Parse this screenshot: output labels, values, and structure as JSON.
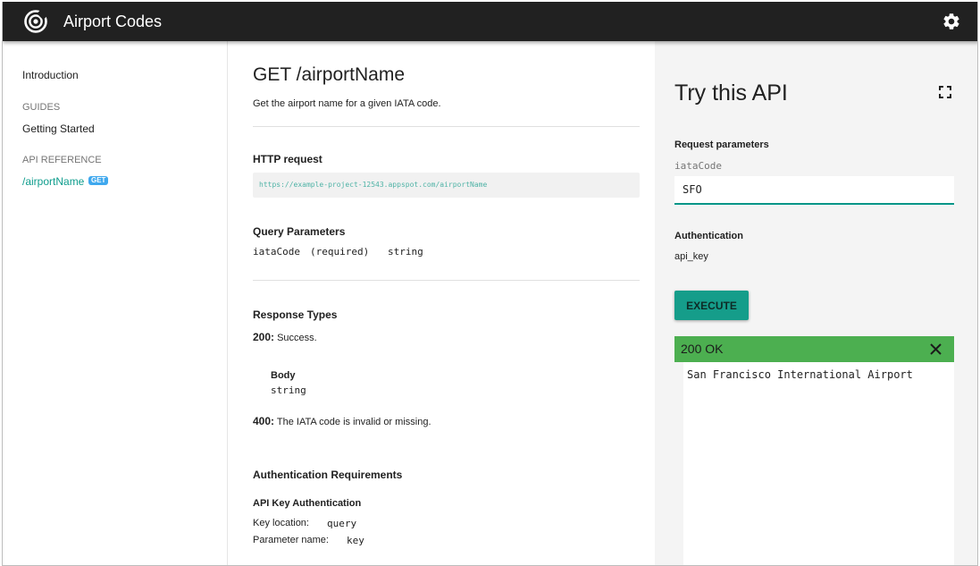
{
  "header": {
    "title": "Airport Codes",
    "logo_icon": "target-logo-icon",
    "settings_icon": "gear-icon"
  },
  "sidebar": {
    "intro": "Introduction",
    "guides_heading": "GUIDES",
    "getting_started": "Getting Started",
    "api_reference_heading": "API REFERENCE",
    "active_item": "/airportName",
    "active_badge": "GET"
  },
  "main": {
    "title": "GET /airportName",
    "description": "Get the airport name for a given IATA code.",
    "http_request": {
      "heading": "HTTP request",
      "url": "https://example-project-12543.appspot.com/airportName"
    },
    "query_parameters": {
      "heading": "Query Parameters",
      "name": "iataCode",
      "required": "(required)",
      "type": "string"
    },
    "response_types": {
      "heading": "Response Types",
      "ok_code": "200:",
      "ok_text": "Success.",
      "body_label": "Body",
      "body_type": "string",
      "err_code": "400:",
      "err_text": "The IATA code is invalid or missing."
    },
    "auth": {
      "heading": "Authentication Requirements",
      "subheading": "API Key Authentication",
      "key_location_label": "Key location:",
      "key_location_value": "query",
      "param_name_label": "Parameter name:",
      "param_name_value": "key"
    }
  },
  "try_api": {
    "title": "Try this API",
    "fullscreen_icon": "fullscreen-icon",
    "request_params_label": "Request parameters",
    "param_label": "iataCode",
    "param_value": "SFO",
    "auth_label": "Authentication",
    "auth_value": "api_key",
    "execute_label": "EXECUTE",
    "response_status": "200 OK",
    "response_body": "San Francisco International Airport",
    "close_icon": "close-icon"
  },
  "colors": {
    "accent": "#009688",
    "success": "#4caf50",
    "header_bg": "#212121",
    "badge": "#3fa8ee"
  }
}
